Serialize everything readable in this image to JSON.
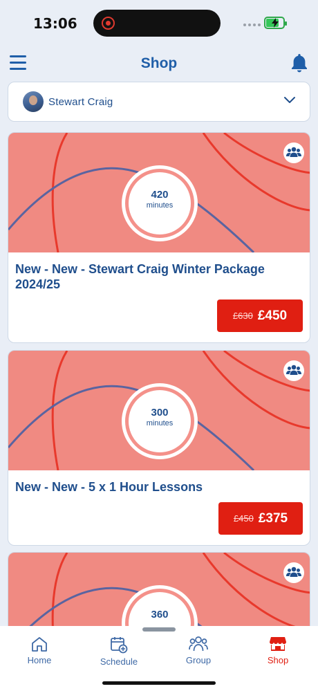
{
  "status_bar": {
    "time": "13:06"
  },
  "header": {
    "title": "Shop"
  },
  "user_selector": {
    "name": "Stewart  Craig"
  },
  "packages": [
    {
      "minutes": "420",
      "minutes_label": "minutes",
      "title": "New - New - Stewart Craig Winter Package 2024/25",
      "old_price": "£630",
      "price": "£450"
    },
    {
      "minutes": "300",
      "minutes_label": "minutes",
      "title": "New - New - 5 x 1 Hour Lessons",
      "old_price": "£450",
      "price": "£375"
    },
    {
      "minutes": "360"
    }
  ],
  "tabbar": {
    "tabs": [
      {
        "label": "Home",
        "icon": "home-icon"
      },
      {
        "label": "Schedule",
        "icon": "calendar-plus-icon"
      },
      {
        "label": "Group",
        "icon": "group-icon"
      },
      {
        "label": "Shop",
        "icon": "shop-icon",
        "active": true
      }
    ]
  },
  "colors": {
    "accent": "#1f5ea8",
    "price": "#e01f12",
    "banner": "#f08a82",
    "background": "#e9eef6"
  }
}
